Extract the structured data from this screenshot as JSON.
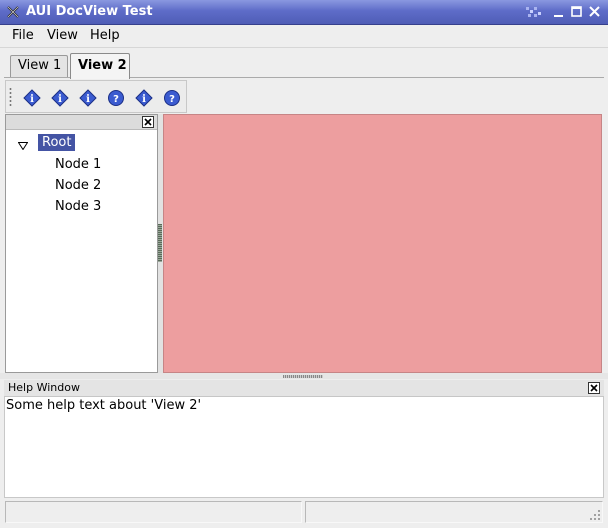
{
  "window": {
    "title": "AUI DocView Test"
  },
  "menubar": {
    "items": [
      {
        "label": "File"
      },
      {
        "label": "View"
      },
      {
        "label": "Help"
      }
    ]
  },
  "tabs": [
    {
      "label": "View 1",
      "selected": false
    },
    {
      "label": "View 2",
      "selected": true
    }
  ],
  "toolbar": {
    "buttons": [
      {
        "icon": "info-icon"
      },
      {
        "icon": "info-icon"
      },
      {
        "icon": "info-icon"
      },
      {
        "icon": "help-icon"
      },
      {
        "icon": "info-icon"
      },
      {
        "icon": "help-icon"
      }
    ]
  },
  "tree": {
    "root": {
      "label": "Root",
      "expanded": true,
      "selected": true
    },
    "children": [
      {
        "label": "Node 1"
      },
      {
        "label": "Node 2"
      },
      {
        "label": "Node 3"
      }
    ]
  },
  "doc_area": {
    "color": "#ed9e9f"
  },
  "help_panel": {
    "title": "Help Window",
    "text": "Some help text about 'View 2'"
  },
  "colors": {
    "titlebar": "#5e6cc8",
    "selection": "#4454a4",
    "toolbar_icon": "#3b5bd0"
  }
}
